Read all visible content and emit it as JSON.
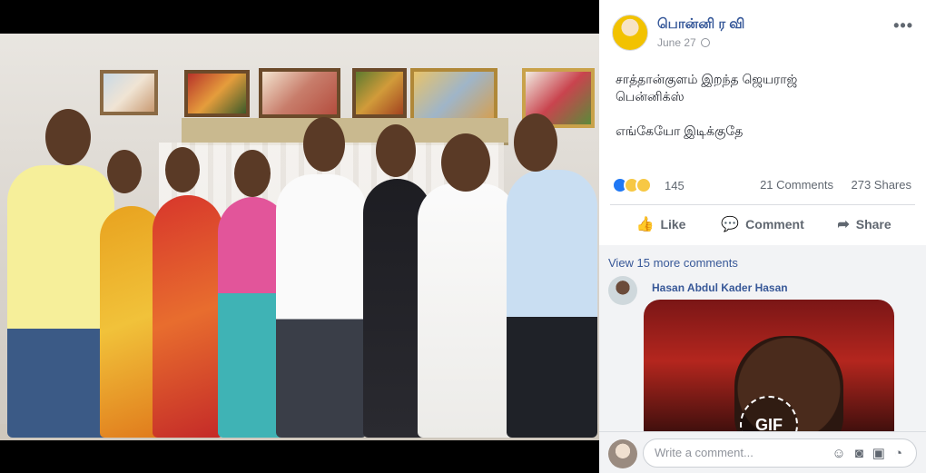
{
  "post": {
    "author": "பொன்னி ர வி",
    "date": "June 27",
    "more_icon": "more-icon",
    "text_line1": "சாத்தான்குளம் இறந்த ஜெயராஜ்",
    "text_line2": "பென்னிக்ஸ்",
    "text_line3": "எங்கேயோ இடிக்குதே"
  },
  "reactions": {
    "count": "145",
    "comments": "21 Comments",
    "shares": "273 Shares"
  },
  "actions": {
    "like": "Like",
    "comment": "Comment",
    "share": "Share"
  },
  "comments": {
    "view_more": "View 15 more comments",
    "first_commenter": "Hasan Abdul Kader Hasan",
    "gif_label": "GIF"
  },
  "composer": {
    "placeholder": "Write a comment..."
  },
  "colors": {
    "link": "#385898",
    "accent": "#2078f4"
  }
}
